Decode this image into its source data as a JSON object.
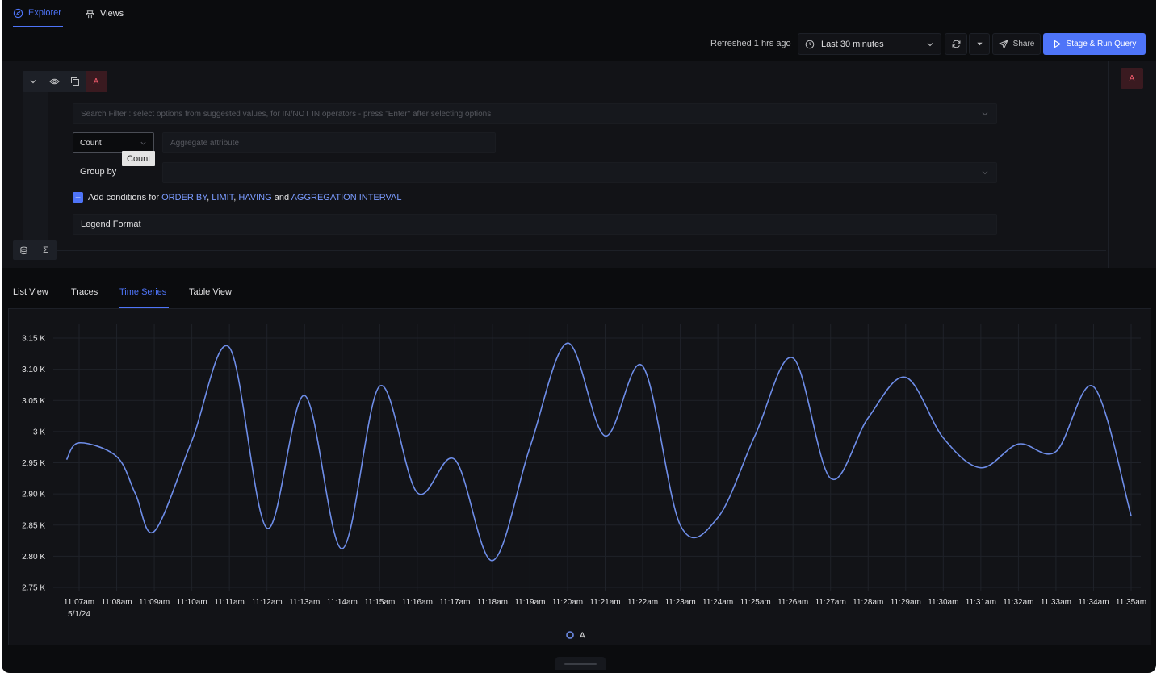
{
  "nav": {
    "tabs": [
      {
        "label": "Explorer",
        "icon": "compass-icon"
      },
      {
        "label": "Views",
        "icon": "views-icon"
      }
    ]
  },
  "toolbar": {
    "refreshed_text": "Refreshed 1 hrs ago",
    "time_range": "Last 30 minutes",
    "share_label": "Share",
    "run_label": "Stage & Run Query"
  },
  "query": {
    "letter": "A",
    "search_placeholder": "Search Filter : select options from suggested values, for IN/NOT IN operators - press \"Enter\" after selecting options",
    "aggregate_operator": "Count",
    "tooltip": "Count",
    "aggregate_placeholder": "Aggregate attribute",
    "group_by_label": "Group by",
    "conditions": {
      "prefix": "Add conditions for",
      "order_by": "ORDER BY",
      "sep1": ",",
      "limit": "LIMIT",
      "sep2": ",",
      "having": "HAVING",
      "and": "and",
      "interval": "AGGREGATION INTERVAL"
    },
    "legend_format_label": "Legend Format",
    "bottom_controls": [
      {
        "icon": "database-icon"
      },
      {
        "label": "Σ"
      }
    ]
  },
  "view_tabs": [
    "List View",
    "Traces",
    "Time Series",
    "Table View"
  ],
  "active_view_tab": "Time Series",
  "colors": {
    "accent": "#4e74f8",
    "line": "#6e8de8",
    "query_letter": "#f15b6c"
  },
  "chart_data": {
    "type": "line",
    "y_tick_labels": [
      "3.15 K",
      "3.10 K",
      "3.05 K",
      "3 K",
      "2.95 K",
      "2.90 K",
      "2.85 K",
      "2.80 K",
      "2.75 K"
    ],
    "ylim": [
      2750,
      3150
    ],
    "x_tick_labels": [
      "11:07am",
      "11:08am",
      "11:09am",
      "11:10am",
      "11:11am",
      "11:12am",
      "11:13am",
      "11:14am",
      "11:15am",
      "11:16am",
      "11:17am",
      "11:18am",
      "11:19am",
      "11:20am",
      "11:21am",
      "11:22am",
      "11:23am",
      "11:24am",
      "11:25am",
      "11:26am",
      "11:27am",
      "11:28am",
      "11:29am",
      "11:30am",
      "11:31am",
      "11:32am",
      "11:33am",
      "11:34am",
      "11:35am"
    ],
    "x_date_label": "5/1/24",
    "grid": true,
    "legend": "bottom-center",
    "series": [
      {
        "name": "A",
        "x": [
          "11:06:40am",
          "11:07am",
          "11:08am",
          "11:08:30am",
          "11:09am",
          "11:10am",
          "11:11am",
          "11:12am",
          "11:13am",
          "11:14am",
          "11:15am",
          "11:16am",
          "11:17am",
          "11:18am",
          "11:19am",
          "11:20am",
          "11:21am",
          "11:22am",
          "11:23am",
          "11:24am",
          "11:25am",
          "11:26am",
          "11:27am",
          "11:28am",
          "11:29am",
          "11:30am",
          "11:31am",
          "11:32am",
          "11:33am",
          "11:34am",
          "11:35am"
        ],
        "values": [
          2955,
          2982,
          2960,
          2900,
          2840,
          2985,
          3135,
          2845,
          3058,
          2812,
          3073,
          2902,
          2955,
          2793,
          2975,
          3142,
          2993,
          3105,
          2850,
          2862,
          2995,
          3118,
          2925,
          3022,
          3087,
          2990,
          2942,
          2980,
          2968,
          3072,
          2865
        ]
      }
    ]
  }
}
